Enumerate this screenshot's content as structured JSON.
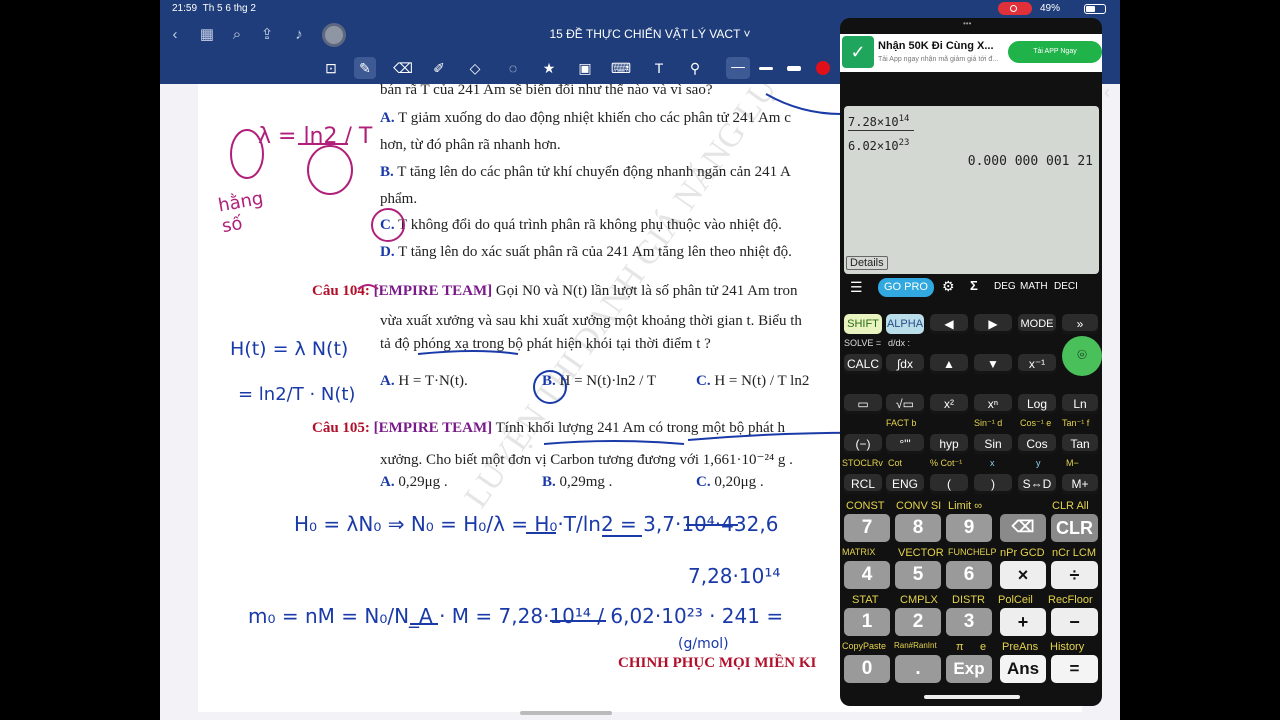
{
  "status": {
    "time": "21:59",
    "date": "Th 5 6 thg 2",
    "battery": "49%"
  },
  "nav": {
    "title": "15 ĐỀ THỰC CHIẾN VẬT LÝ VACT"
  },
  "doc": {
    "q_prev_line": "bán rã T của 241 Am sẽ biến đổi như thế nào và vì sao?",
    "a_label": "A.",
    "a_text": "T giảm xuống do dao động nhiệt khiến cho các phân tử 241 Am c",
    "a_text2": "hơn, từ đó phân rã nhanh hơn.",
    "b_label": "B.",
    "b_text": "T tăng lên do các phân tử khí chuyển động nhanh ngăn cản 241 A",
    "b_text2": "phẩm.",
    "c_label": "C.",
    "c_text": "T không đổi do quá trình phân rã không phụ thuộc vào nhiệt độ.",
    "d_label": "D.",
    "d_text": "T tăng lên do xác suất phân rã của 241 Am tăng lên theo nhiệt độ.",
    "q104_label": "Câu 104:",
    "q104_team": "[EMPIRE TEAM]",
    "q104_text": "Gọi N0 và N(t) lần lượt là số phân tử 241 Am tron",
    "q104_text2": "vừa xuất xưởng và sau khi xuất xưởng một khoảng thời gian t. Biểu th",
    "q104_text3": "tả độ phóng xạ trong bộ phát hiện khói tại thời điểm t ?",
    "q104_a_label": "A.",
    "q104_a": "H = T·N(t).",
    "q104_b_label": "B.",
    "q104_b": "H = N(t)·ln2 / T",
    "q104_c_label": "C.",
    "q104_c": "H = N(t) / T ln2",
    "q105_label": "Câu 105:",
    "q105_team": "[EMPIRE TEAM]",
    "q105_text": "Tính khối lượng 241 Am có trong một bộ phát h",
    "q105_text2": "xưởng. Cho biết một đơn vị Carbon tương đương với 1,661·10⁻²⁴ g .",
    "q105_a_label": "A.",
    "q105_a": "0,29μg .",
    "q105_b_label": "B.",
    "q105_b": "0,29mg .",
    "q105_c_label": "C.",
    "q105_c": "0,20μg .",
    "footer_red": "CHINH PHỤC MỌI MIỀN KI",
    "watermark": "LUYỆN THI DANH GIÁ NĂNG LỰC"
  },
  "handwriting": {
    "lambda_eq": "λ = ln2 / T",
    "hang_so": "hằng số",
    "h_eq": "H(t) = λ N(t)",
    "h_eq2": "= ln2/T · N(t)",
    "h0_eq": "H₀ = λN₀ ⇒ N₀ = H₀/λ = H₀·T/ln2 = 3,7·10⁴·432,6",
    "result": "7,28·10¹⁴",
    "m0_eq": "m₀ = nM = N₀/N_A · M = 7,28·10¹⁴ / 6,02·10²³ · 241 =",
    "unit": "(g/mol)"
  },
  "ad": {
    "title": "Nhận 50K Đi Cùng X...",
    "sub": "Tải App ngay nhận mã giảm giá tới đ...",
    "button": "Tải APP Ngay"
  },
  "calculator": {
    "numerator": "7.28×10",
    "num_exp": "14",
    "denominator": "6.02×10",
    "den_exp": "23",
    "result": "0.000 000 001 21",
    "details": "Details",
    "gopro": "GO PRO",
    "modes": [
      "DEG",
      "MATH",
      "DECI"
    ],
    "keys": {
      "shift": "SHIFT",
      "alpha": "ALPHA",
      "mode": "MODE",
      "calc": "CALC",
      "integral": "∫dx",
      "log": "Log",
      "ln": "Ln",
      "neg": "(−)",
      "deg": "°'\"",
      "hyp": "hyp",
      "sin": "Sin",
      "cos": "Cos",
      "tan": "Tan",
      "rcl": "RCL",
      "eng": "ENG",
      "lparen": "(",
      "rparen": ")",
      "sd": "S⇔D",
      "mplus": "M+",
      "n7": "7",
      "n8": "8",
      "n9": "9",
      "clr": "CLR",
      "n4": "4",
      "n5": "5",
      "n6": "6",
      "mul": "×",
      "div": "÷",
      "n1": "1",
      "n2": "2",
      "n3": "3",
      "plus": "+",
      "minus": "−",
      "n0": "0",
      "dot": ".",
      "exp": "Exp",
      "ans": "Ans",
      "eq": "="
    },
    "labels": {
      "solve": "SOLVE =",
      "ddx": "d/dx :",
      "const": "CONST",
      "conv": "CONV SI",
      "limit": "Limit ∞",
      "clrall": "CLR All",
      "matrix": "MATRIX",
      "vector": "VECTOR",
      "funchelp": "FUNCHELP",
      "npr": "nPr GCD",
      "ncr": "nCr LCM",
      "stat": "STAT",
      "cmplx": "CMPLX",
      "distr": "DISTR",
      "polceil": "PolCeil",
      "recfloor": "RecFloor",
      "copypaste": "CopyPaste",
      "ranint": "Ran#RanInt",
      "pi": "π",
      "e": "e",
      "preans": "PreAns",
      "history": "History",
      "stoclrv": "STOCLRv",
      "cot": "Cot",
      "cotinv": "% Cot⁻¹",
      "x": "x",
      "y": "y",
      "m": "M−",
      "fact": "FACT b",
      "sininv": "Sin⁻¹ d",
      "cosinv": "Cos⁻¹ e",
      "taninv": "Tan⁻¹ f"
    }
  }
}
